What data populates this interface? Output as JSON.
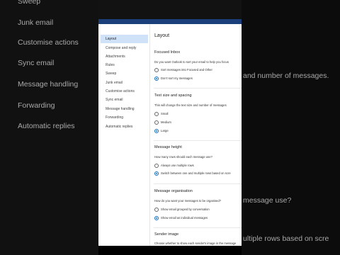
{
  "background_list": [
    "Sweep",
    "Junk email",
    "Customise actions",
    "Sync email",
    "Message handling",
    "Forwarding",
    "Automatic replies"
  ],
  "background_right": {
    "line1": "and number of messages.",
    "line2": "message use?",
    "line3": "ultiple rows based on scre"
  },
  "nav": {
    "items": [
      "Layout",
      "Compose and reply",
      "Attachments",
      "Rules",
      "Sweep",
      "Junk email",
      "Customise actions",
      "Sync email",
      "Message handling",
      "Forwarding",
      "Automatic replies"
    ],
    "active": "Layout"
  },
  "content": {
    "title": "Layout",
    "focused_inbox": {
      "heading": "Focused Inbox",
      "question": "Do you want Outlook to sort your email to help you focus",
      "options": [
        "Sort messages into Focused and Other",
        "Don't sort my messages"
      ],
      "selected": "Don't sort my messages"
    },
    "text_size": {
      "heading": "Text size and spacing",
      "question": "This will change the text size and number of messages",
      "options": [
        "Small",
        "Medium",
        "Large"
      ],
      "selected": "Large"
    },
    "message_height": {
      "heading": "Message height",
      "question": "How many rows should each message use?",
      "options": [
        "Always use multiple rows",
        "Switch between one and multiple rows based on scre"
      ],
      "selected": "Switch between one and multiple rows based on scre"
    },
    "message_organisation": {
      "heading": "Message organisation",
      "question": "How do you want your messages to be organised?",
      "options": [
        "Show email grouped by conversation",
        "Show email as individual messages"
      ],
      "selected": "Show email as individual messages"
    },
    "sender_image": {
      "heading": "Sender image",
      "question": "Choose whether to show each sender's image in the message"
    }
  },
  "colors": {
    "accent": "#0f6cbd",
    "nav_active_bg": "#cfe2f7",
    "header_blue": "#1b3f7a"
  }
}
